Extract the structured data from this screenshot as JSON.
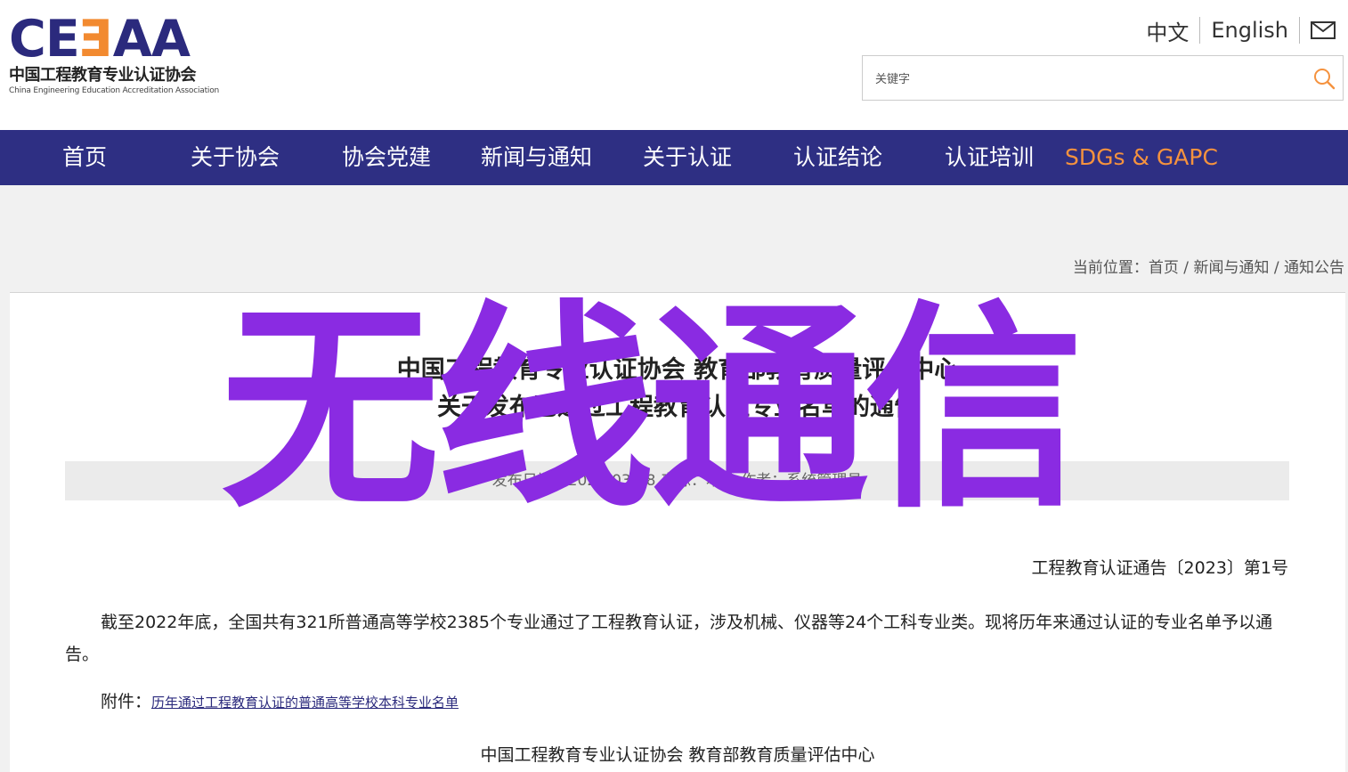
{
  "logo": {
    "mark_left": "CE",
    "mark_mid": "E",
    "mark_right": "AA",
    "name_cn": "中国工程教育专业认证协会",
    "name_en": "China Engineering Education Accreditation Association"
  },
  "lang": {
    "cn": "中文",
    "en": "English",
    "mail_icon": "mail-icon"
  },
  "search": {
    "placeholder": "关键字",
    "value": "",
    "icon": "search-icon"
  },
  "nav": {
    "items": [
      "首页",
      "关于协会",
      "协会党建",
      "新闻与通知",
      "关于认证",
      "认证结论",
      "认证培训",
      "SDGs & GAPC"
    ]
  },
  "breadcrumb": {
    "prefix": "当前位置：",
    "items": [
      "首页",
      "新闻与通知",
      "通知公告"
    ],
    "sep": " / "
  },
  "article": {
    "title_line1": "中国工程教育专业认证协会 教育部教育质量评估中心",
    "title_line2": "关于发布已通过工程教育认证专业名单的通告",
    "meta": "发布日期：2023-03-28  来源：本站  作者：系统管理员",
    "notice_no": "工程教育认证通告〔2023〕第1号",
    "body": "截至2022年底，全国共有321所普通高等学校2385个专业通过了工程教育认证，涉及机械、仪器等24个工科专业类。现将历年来通过认证的专业名单予以通告。",
    "attach_label": "附件：",
    "attach_link": "历年通过工程教育认证的普通高等学校本科专业名单",
    "signature": "中国工程教育专业认证协会    教育部教育质量评估中心"
  },
  "watermark": {
    "text": "无线通信",
    "color": "#8a2be2"
  },
  "colors": {
    "nav_bg": "#2e2f83",
    "highlight": "#f5923e",
    "logo_blue": "#2b2a7d"
  }
}
